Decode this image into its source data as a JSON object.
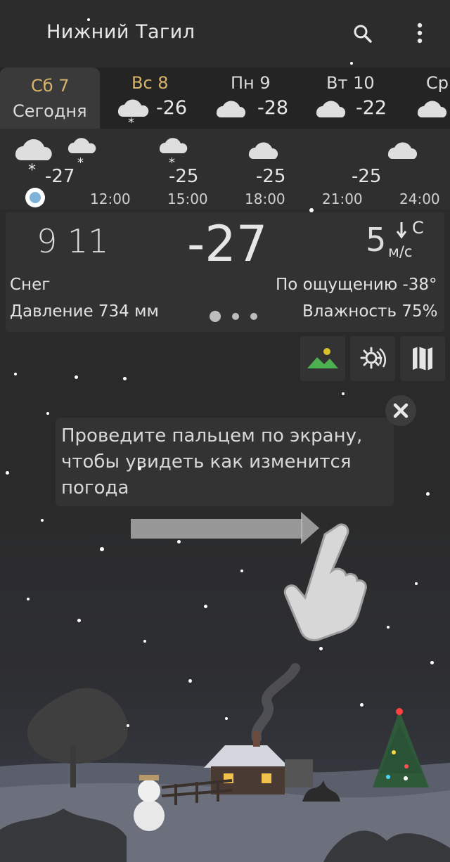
{
  "header": {
    "city": "Нижний Тагил",
    "search_icon": "search-icon",
    "menu_icon": "more-vert-icon"
  },
  "days": [
    {
      "name": "Сб 7",
      "sub": "Сегодня",
      "temp": "",
      "icon": ""
    },
    {
      "name": "Вс 8",
      "temp": "-26",
      "icon": "snow-cloud-icon"
    },
    {
      "name": "Пн 9",
      "temp": "-28",
      "icon": "cloud-icon"
    },
    {
      "name": "Вт 10",
      "temp": "-22",
      "icon": "cloud-icon"
    },
    {
      "name": "Ср",
      "temp": "",
      "icon": "cloud-icon"
    }
  ],
  "hourly": {
    "temps": [
      "-27",
      "-25",
      "-25",
      "-25"
    ],
    "times": [
      "12:00",
      "15:00",
      "18:00",
      "21:00",
      "24:00"
    ]
  },
  "current": {
    "time": "9 11",
    "temp": "-27",
    "wind_speed": "5",
    "wind_unit": "м/с",
    "wind_dir": "С",
    "condition": "Снег",
    "feels_like": "По ощущению -38°",
    "pressure": "Давление 734 мм",
    "humidity": "Влажность 75%"
  },
  "actions": [
    "landscape-icon",
    "weather-radar-icon",
    "map-icon"
  ],
  "hint": {
    "text": "Проведите пальцем по экрану, чтобы увидеть как изменится погода"
  },
  "colors": {
    "accent_gold": "#d8b46a",
    "background": "#2a2a2a",
    "card": "#323232",
    "timeline_dot": "#7fb2d8"
  }
}
